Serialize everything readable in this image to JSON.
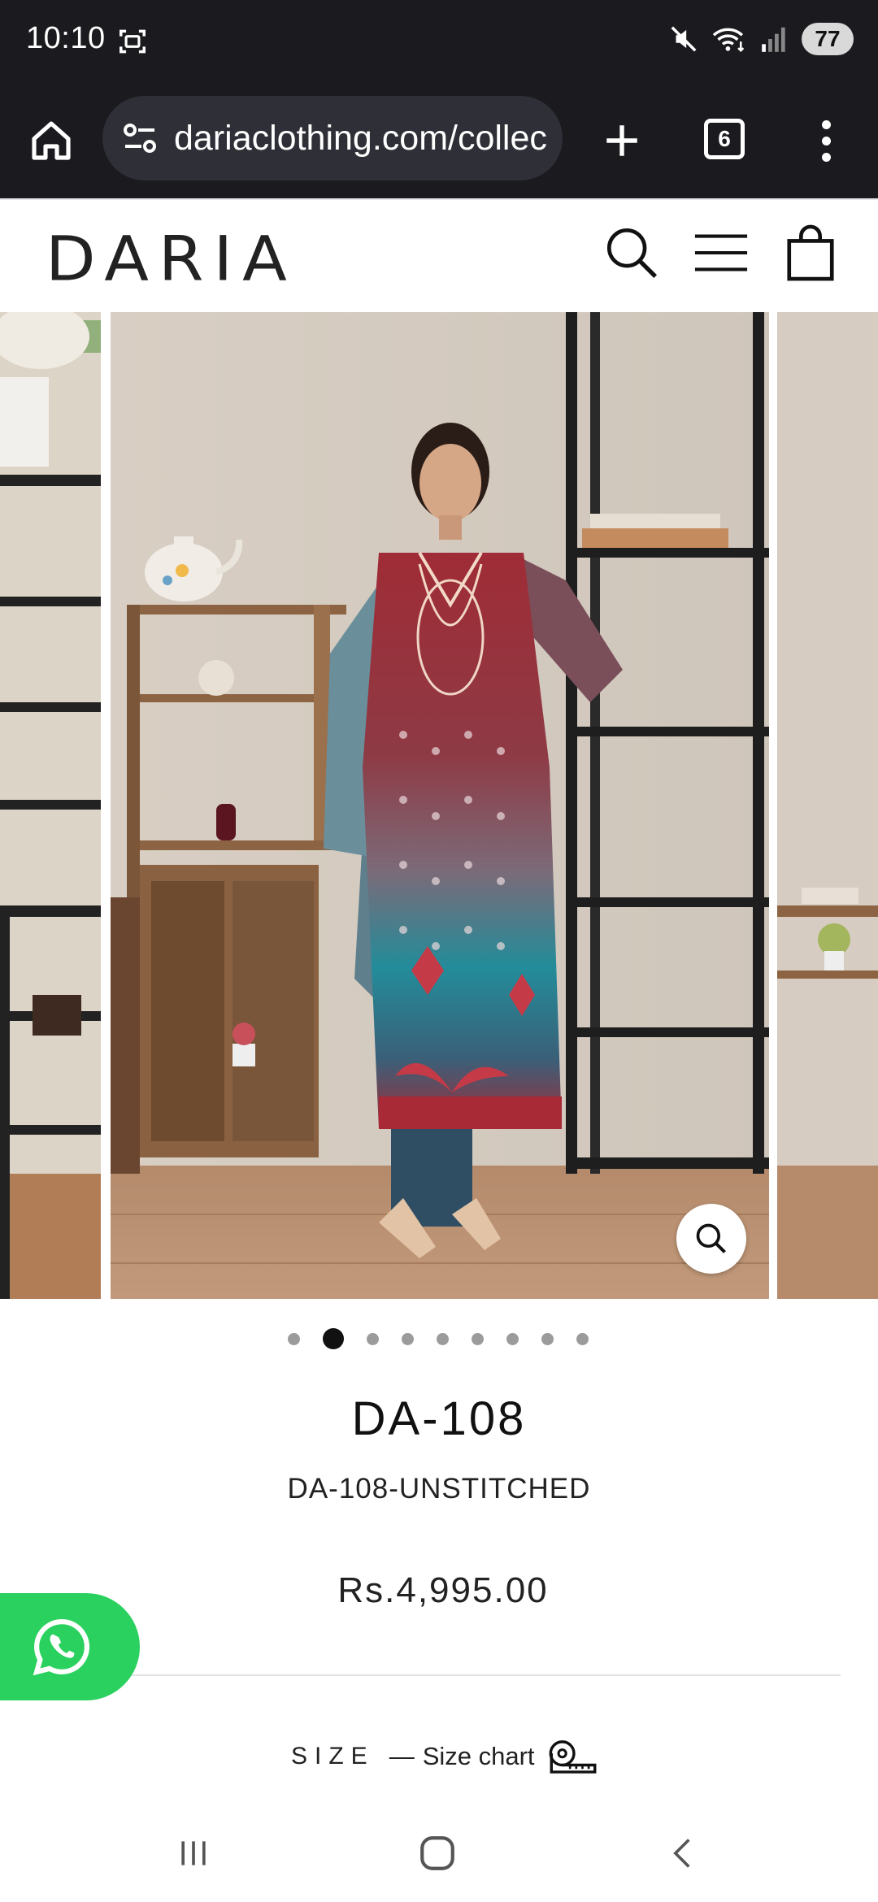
{
  "status_bar": {
    "time": "10:10",
    "battery": "77",
    "icons": [
      "screenshot-icon",
      "mute-icon",
      "wifi-icon",
      "signal-icon"
    ]
  },
  "browser": {
    "url": "dariaclothing.com/collec",
    "tab_count": "6",
    "icons": [
      "home-icon",
      "site-info-icon",
      "new-tab-icon",
      "menu-icon"
    ]
  },
  "site_header": {
    "logo": "DARIA",
    "icons": [
      "search-icon",
      "hamburger-menu-icon",
      "shopping-bag-icon"
    ]
  },
  "gallery": {
    "total_images": 9,
    "active_index": 1
  },
  "product": {
    "title": "DA-108",
    "sku": "DA-108-UNSTITCHED",
    "price": "Rs.4,995.00",
    "size_label": "SIZE",
    "size_chart_label": "Size chart"
  },
  "colors": {
    "whatsapp": "#2bd15f",
    "dress_red": "#9e2b35",
    "dress_teal": "#1b8797"
  }
}
